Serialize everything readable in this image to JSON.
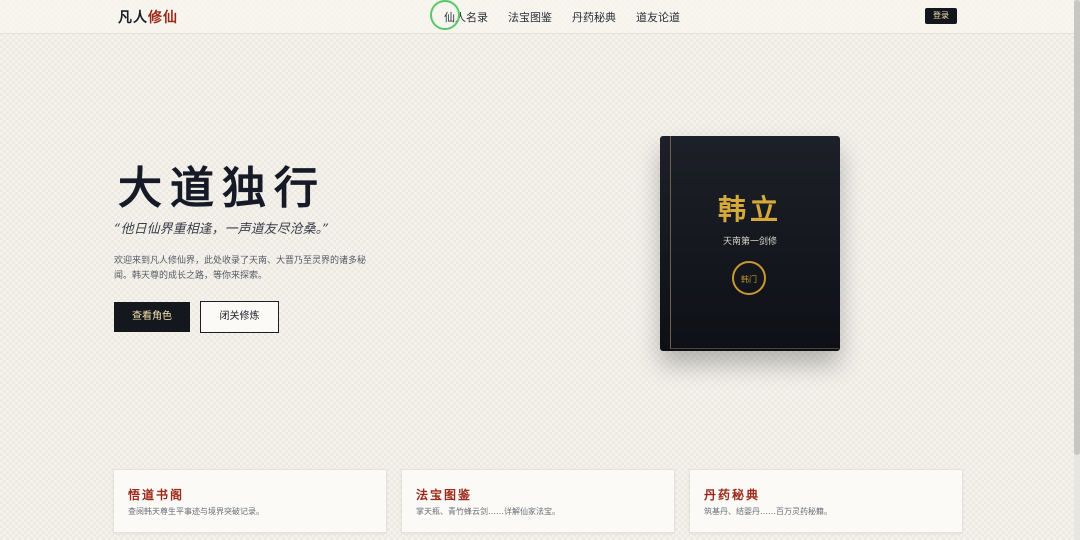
{
  "header": {
    "logo_main": "凡人",
    "logo_accent": "修仙",
    "nav": [
      "仙人名录",
      "法宝图鉴",
      "丹药秘典",
      "道友论道"
    ],
    "login_label": "登录"
  },
  "hero": {
    "title": "大道独行",
    "quote": "“他日仙界重相逢，一声道友尽沧桑。”",
    "description": "欢迎来到凡人修仙界，此处收录了天南、大晋乃至灵界的诸多秘闻。韩天尊的成长之路，等你来探索。",
    "primary_button": "查看角色",
    "secondary_button": "闭关修炼"
  },
  "character_card": {
    "name": "韩立",
    "subtitle": "天南第一剑修",
    "seal_text": "韩门"
  },
  "features": [
    {
      "title": "悟道书阁",
      "description": "查阅韩天尊生平事迹与境界突破记录。"
    },
    {
      "title": "法宝图鉴",
      "description": "掌天瓶、青竹蜂云剑……详解仙家法宝。"
    },
    {
      "title": "丹药秘典",
      "description": "筑基丹、结婴丹……百万灵药秘籍。"
    }
  ],
  "colors": {
    "accent": "#9b2a1a",
    "gold": "#d6aa3a",
    "dark": "#15171e"
  }
}
